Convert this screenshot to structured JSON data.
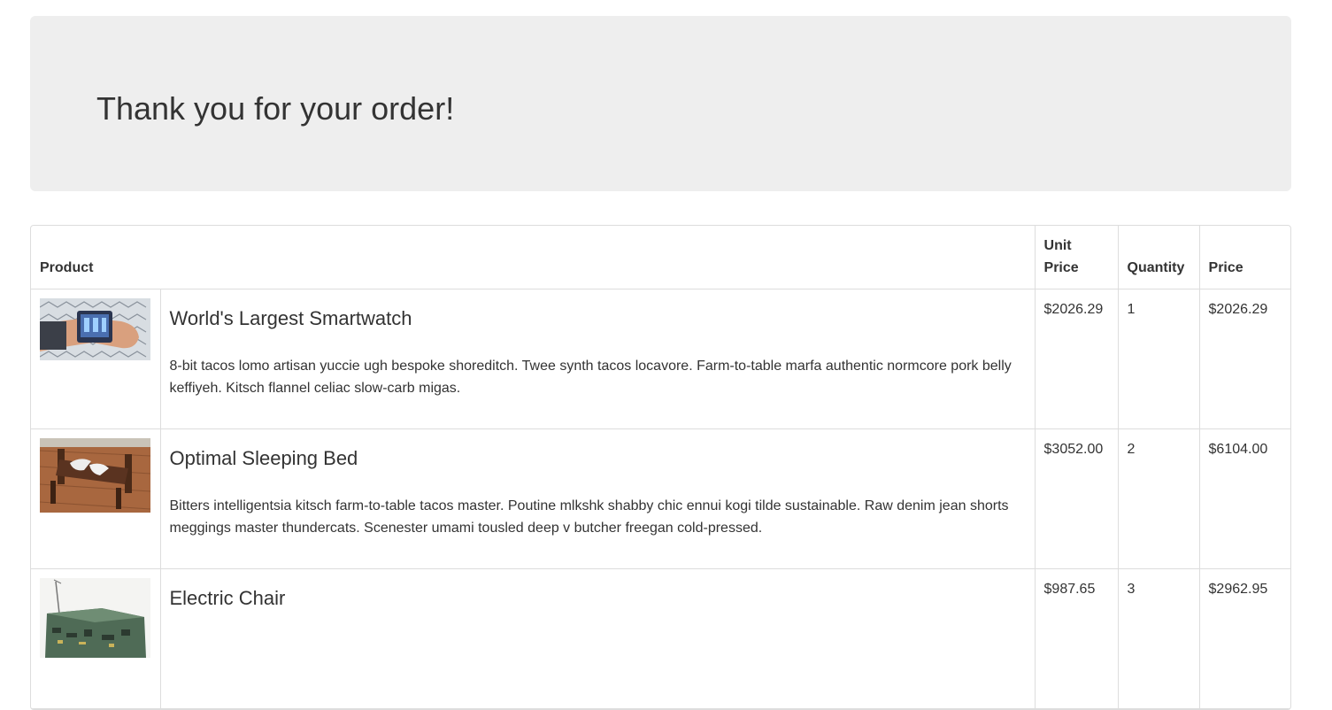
{
  "header": {
    "title": "Thank you for your order!"
  },
  "table": {
    "columns": {
      "product": "Product",
      "unit_price": "Unit Price",
      "quantity": "Quantity",
      "price": "Price"
    },
    "rows": [
      {
        "image_icon": "smartwatch-product-image",
        "name": "World's Largest Smartwatch",
        "description": "8-bit tacos lomo artisan yuccie ugh bespoke shoreditch. Twee synth tacos locavore. Farm-to-table marfa authentic normcore pork belly keffiyeh. Kitsch flannel celiac slow-carb migas.",
        "unit_price": "$2026.29",
        "quantity": "1",
        "price": "$2026.29"
      },
      {
        "image_icon": "bed-product-image",
        "name": "Optimal Sleeping Bed",
        "description": "Bitters intelligentsia kitsch farm-to-table tacos master. Poutine mlkshk shabby chic ennui kogi tilde sustainable. Raw denim jean shorts meggings master thundercats. Scenester umami tousled deep v butcher freegan cold-pressed.",
        "unit_price": "$3052.00",
        "quantity": "2",
        "price": "$6104.00"
      },
      {
        "image_icon": "chair-product-image",
        "name": "Electric Chair",
        "description": "",
        "unit_price": "$987.65",
        "quantity": "3",
        "price": "$2962.95"
      }
    ]
  }
}
